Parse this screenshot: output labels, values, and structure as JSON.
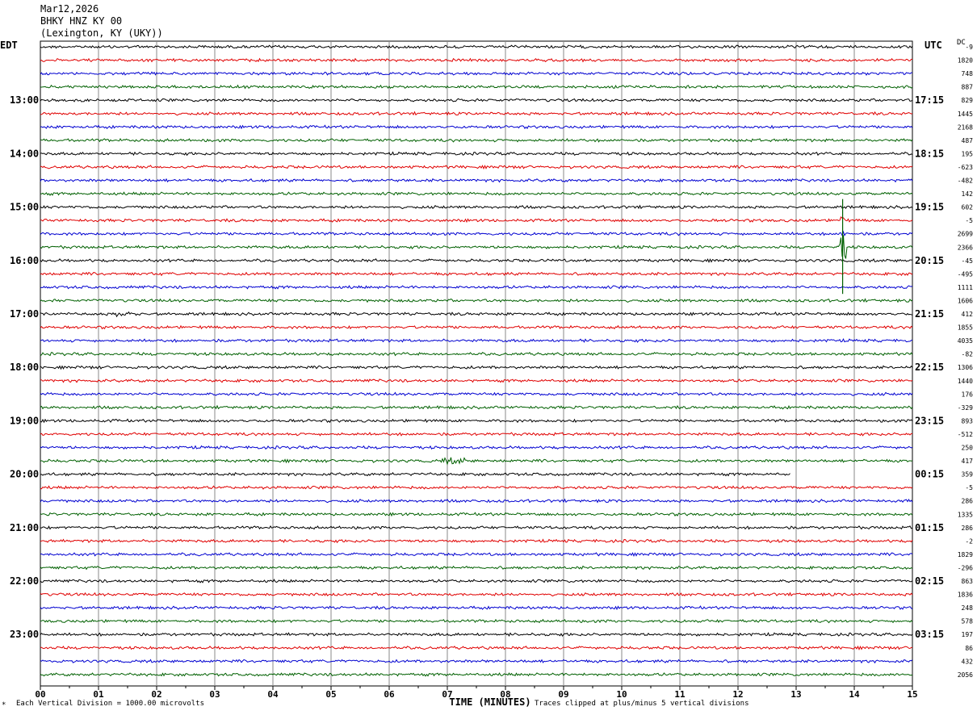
{
  "header": {
    "date": "Mar12,2026",
    "station": "BHKY HNZ KY 00",
    "location": "(Lexington, KY (UKY))"
  },
  "left_timezone": "EDT",
  "right_timezone": "UTC",
  "dc_label": "DC",
  "footer": {
    "scale_note": "Each Vertical Division = 1000.00 microvolts",
    "clip_note": "Traces clipped at plus/minus 5 vertical divisions",
    "mark": "*"
  },
  "colors": {
    "trace_cycle": [
      "#000000",
      "#e00000",
      "#0000d0",
      "#006000"
    ],
    "grid": "#888888"
  },
  "chart_data": {
    "type": "line",
    "title": "BHKY HNZ KY 00",
    "xlabel": "TIME (MINUTES)",
    "ylabel": "",
    "xlim": [
      0,
      15
    ],
    "x_ticks": [
      "00",
      "01",
      "02",
      "03",
      "04",
      "05",
      "06",
      "07",
      "08",
      "09",
      "10",
      "11",
      "12",
      "13",
      "14",
      "15"
    ],
    "rows": 48,
    "left_hour_labels": [
      "13:00",
      "14:00",
      "15:00",
      "16:00",
      "17:00",
      "18:00",
      "19:00",
      "20:00",
      "21:00",
      "22:00",
      "23:00"
    ],
    "right_hour_labels": [
      "17:15",
      "18:15",
      "19:15",
      "20:15",
      "21:15",
      "22:15",
      "23:15",
      "00:15",
      "01:15",
      "02:15",
      "03:15"
    ],
    "dc_offsets": [
      "-9",
      "1820",
      "748",
      "887",
      "829",
      "1445",
      "2168",
      "487",
      "195",
      "-623",
      "-482",
      "142",
      "602",
      "-5",
      "2699",
      "2366",
      "-45",
      "-495",
      "1111",
      "1606",
      "412",
      "1855",
      "4035",
      "-82",
      "1306",
      "1440",
      "176",
      "-329",
      "893",
      "-512",
      "250",
      "417",
      "359",
      "-5",
      "286",
      "1335",
      "286",
      "-2",
      "1829",
      "-296",
      "863",
      "1836",
      "248",
      "578",
      "197",
      "86",
      "432",
      "2056"
    ],
    "events": [
      {
        "row": 13,
        "minute": 13.8,
        "note": "spike"
      },
      {
        "row": 14,
        "minute": 13.8,
        "note": "spike"
      },
      {
        "row": 15,
        "minute": 13.8,
        "note": "large spike"
      },
      {
        "row": 20,
        "minute": 1.5,
        "note": "burst"
      },
      {
        "row": 31,
        "minute": 7.1,
        "note": "burst"
      }
    ],
    "gap": {
      "row": 32,
      "from_minute": 12.9,
      "to_minute": 15
    }
  }
}
